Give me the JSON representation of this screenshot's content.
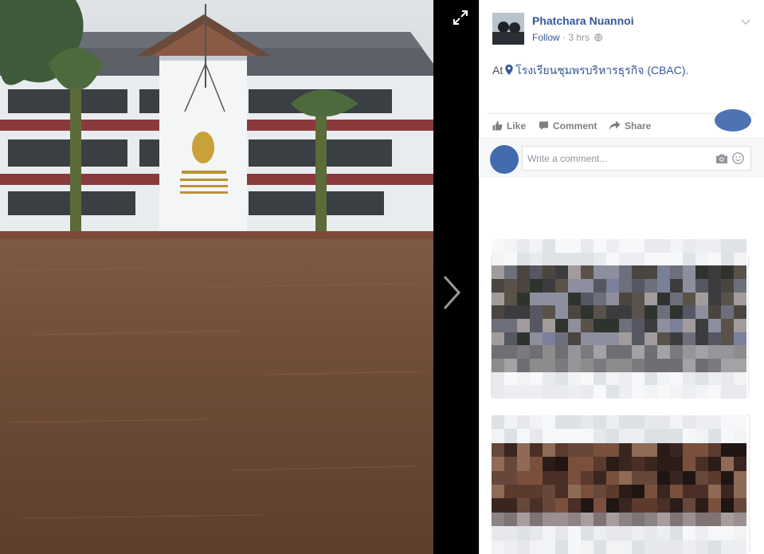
{
  "post": {
    "author": "Phatchara Nuannoi",
    "follow": "Follow",
    "separator": " · ",
    "time": "3 hrs",
    "audience_icon": "globe-icon",
    "at_prefix": "At",
    "place": "โรงเรียนชุมพรบริหารธุรกิจ (CBAC)."
  },
  "actions": {
    "like": "Like",
    "comment": "Comment",
    "share": "Share"
  },
  "composer": {
    "placeholder": "Write a comment..."
  },
  "icons": {
    "expand": "expand-icon",
    "next": "chevron-right-icon",
    "options": "chevron-down-icon",
    "camera": "camera-icon",
    "emoji": "emoji-icon",
    "pin": "location-pin-icon"
  },
  "colors": {
    "link": "#365899",
    "meta": "#90949c",
    "action": "#7f7f7f",
    "flood_water": "#6b4a36",
    "building_wall": "#eef0f2",
    "building_stripe": "#8a3a3c",
    "roof": "#5c6068"
  }
}
